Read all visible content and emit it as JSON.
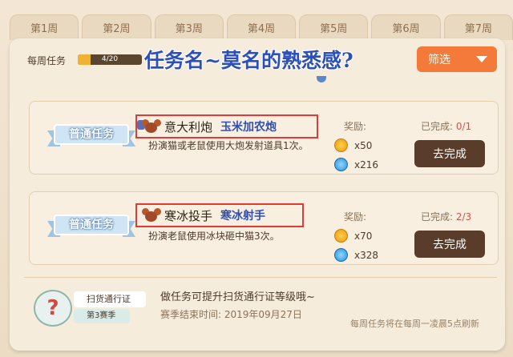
{
  "tabs": [
    "第1周",
    "第2周",
    "第3周",
    "第4周",
    "第5周",
    "第6周",
    "第7周"
  ],
  "header": {
    "weekly_label": "每周任务",
    "progress_text": "4/20",
    "progress_fraction": 0.2,
    "overlay_title": "任务名~莫名的熟悉感?",
    "filter_label": "筛选"
  },
  "tasks": [
    {
      "type_label": "普通任务",
      "name": "意大利炮",
      "name_annotation": "玉米加农炮",
      "desc": "扮演猫或老鼠使用大炮发射道具1次。",
      "reward_label": "奖励:",
      "coins": "x50",
      "gems": "x216",
      "done_label": "已完成:",
      "done_count": "0/1",
      "button_label": "去完成"
    },
    {
      "type_label": "普通任务",
      "name": "寒冰投手",
      "name_annotation": "寒冰射手",
      "desc": "扮演老鼠使用冰块砸中猫3次。",
      "reward_label": "奖励:",
      "coins": "x70",
      "gems": "x328",
      "done_label": "已完成:",
      "done_count": "2/3",
      "button_label": "去完成"
    }
  ],
  "footer": {
    "pass_title": "扫货通行证",
    "pass_season": "第3赛季",
    "main_text": "做任务可提升扫货通行证等级哦~",
    "season_end": "赛季结束时间: 2019年09月27日",
    "refresh_note": "每周任务将在每周一凌晨5点刷新"
  }
}
